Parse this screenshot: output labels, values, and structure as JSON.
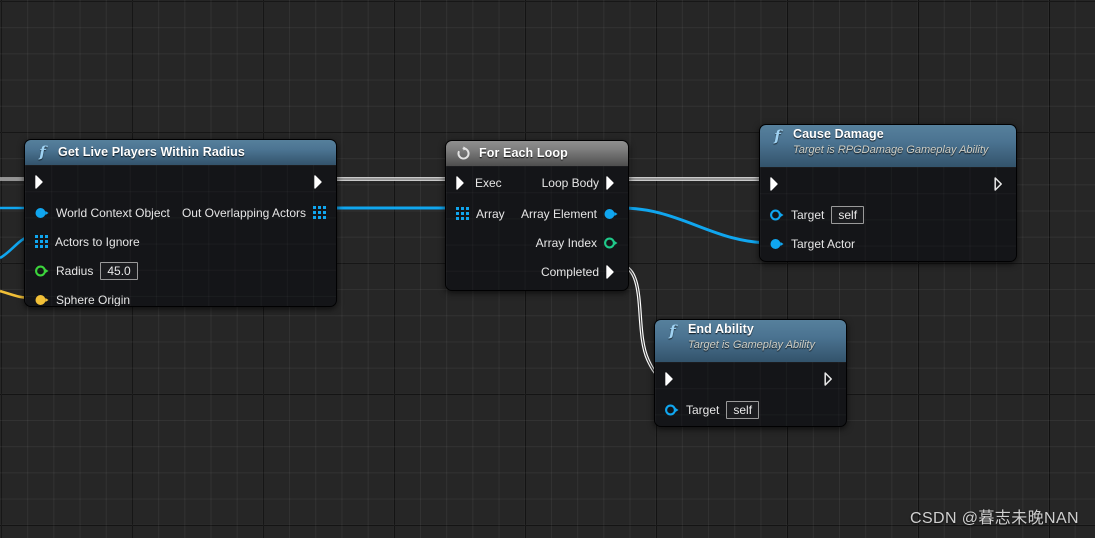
{
  "graph": {
    "background_color": "#262626",
    "grid_minor_color": "#333333",
    "grid_major_color": "#0b0b0b",
    "watermark": "CSDN @暮志未晚NAN"
  },
  "colors": {
    "exec_wire": "#ffffff",
    "object_pin": "#10a6ef",
    "float_pin": "#3cd43c",
    "int_pin": "#1fc98a",
    "vector_pin": "#f2c037",
    "array_pin": "#10a6ef",
    "function_header": "#4b7391",
    "macro_header": "#7d7d7d"
  },
  "nodes": [
    {
      "id": "get-live-players-within-radius",
      "title": "Get Live Players Within Radius",
      "subtitle": "",
      "header_type": "function",
      "icon": "function-f-icon",
      "inputs": [
        {
          "label": "World Context Object",
          "pin": "object-pin",
          "value": ""
        },
        {
          "label": "Actors to Ignore",
          "pin": "array-pin",
          "value": ""
        },
        {
          "label": "Radius",
          "pin": "float-pin",
          "value": "45.0"
        },
        {
          "label": "Sphere Origin",
          "pin": "vector-pin",
          "value": ""
        }
      ],
      "outputs": [
        {
          "label": "Out Overlapping Actors",
          "pin": "array-pin",
          "value": ""
        }
      ]
    },
    {
      "id": "for-each-loop",
      "title": "For Each Loop",
      "subtitle": "",
      "header_type": "macro",
      "icon": "loop-icon",
      "inputs": [
        {
          "label": "Exec",
          "pin": "exec-pin",
          "value": ""
        },
        {
          "label": "Array",
          "pin": "array-pin",
          "value": ""
        }
      ],
      "outputs": [
        {
          "label": "Loop Body",
          "pin": "exec-pin",
          "value": ""
        },
        {
          "label": "Array Element",
          "pin": "object-pin",
          "value": ""
        },
        {
          "label": "Array Index",
          "pin": "int-pin",
          "value": ""
        },
        {
          "label": "Completed",
          "pin": "exec-pin",
          "value": ""
        }
      ]
    },
    {
      "id": "cause-damage",
      "title": "Cause Damage",
      "subtitle": "Target is RPGDamage Gameplay Ability",
      "header_type": "function",
      "icon": "function-f-icon",
      "inputs": [
        {
          "label": "Target",
          "pin": "object-pin-hollow",
          "value": "self"
        },
        {
          "label": "Target Actor",
          "pin": "object-pin",
          "value": ""
        }
      ],
      "outputs": []
    },
    {
      "id": "end-ability",
      "title": "End Ability",
      "subtitle": "Target is Gameplay Ability",
      "header_type": "function",
      "icon": "function-f-icon",
      "inputs": [
        {
          "label": "Target",
          "pin": "object-pin-hollow",
          "value": "self"
        }
      ],
      "outputs": []
    }
  ],
  "labels": {
    "node1_title": "Get Live Players Within Radius",
    "node1_in1": "World Context Object",
    "node1_in2": "Actors to Ignore",
    "node1_in3": "Radius",
    "node1_in3_value": "45.0",
    "node1_in4": "Sphere Origin",
    "node1_out1": "Out Overlapping Actors",
    "node2_title": "For Each Loop",
    "node2_in1": "Exec",
    "node2_in2": "Array",
    "node2_out1": "Loop Body",
    "node2_out2": "Array Element",
    "node2_out3": "Array Index",
    "node2_out4": "Completed",
    "node3_title": "Cause Damage",
    "node3_subtitle": "Target is RPGDamage Gameplay Ability",
    "node3_in1": "Target",
    "node3_in1_value": "self",
    "node3_in2": "Target Actor",
    "node4_title": "End Ability",
    "node4_subtitle": "Target is Gameplay Ability",
    "node4_in1": "Target",
    "node4_in1_value": "self"
  }
}
